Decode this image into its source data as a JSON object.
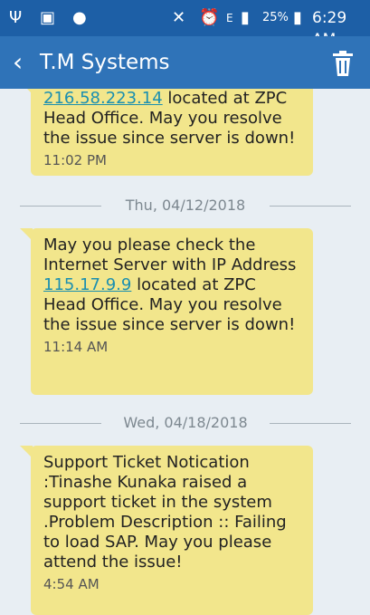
{
  "status_bar": {
    "usb_icon": "usb-icon",
    "gallery_icon": "gallery-icon",
    "app_icon": "app-notification-icon",
    "mute_icon": "mute-icon",
    "alarm_icon": "alarm-icon",
    "data_indicator": "E",
    "signal_icon": "signal-icon",
    "battery_percent": "25%",
    "battery_icon": "battery-charging-icon",
    "time": "6:29 AM"
  },
  "app_bar": {
    "back_icon": "back-icon",
    "title": "T.M Systems",
    "delete_icon": "trash-icon",
    "color": "#2f73b8"
  },
  "messages": [
    {
      "text_prefix": "",
      "link": "216.58.223.14",
      "text_suffix": " located at ZPC Head Office. May you resolve the issue since server is down!",
      "time": "11:02 PM"
    },
    {
      "date_separator": "Thu, 04/12/2018",
      "text_prefix": "May you please check the Internet Server  with IP Address ",
      "link": "115.17.9.9",
      "text_suffix": " located at ZPC Head Office. May you resolve the issue since server is down!",
      "time": "11:14 AM"
    },
    {
      "date_separator": "Wed, 04/18/2018",
      "text": "Support Ticket Notication :Tinashe Kunaka raised a support ticket in the system .Problem Description :: Failing to load SAP. May you please attend the issue!",
      "time": "4:54 AM"
    }
  ],
  "colors": {
    "status_bar": "#1d5fa6",
    "bubble": "#f2e68c",
    "link": "#1b8fb0",
    "chat_background": "#e8eef3"
  }
}
